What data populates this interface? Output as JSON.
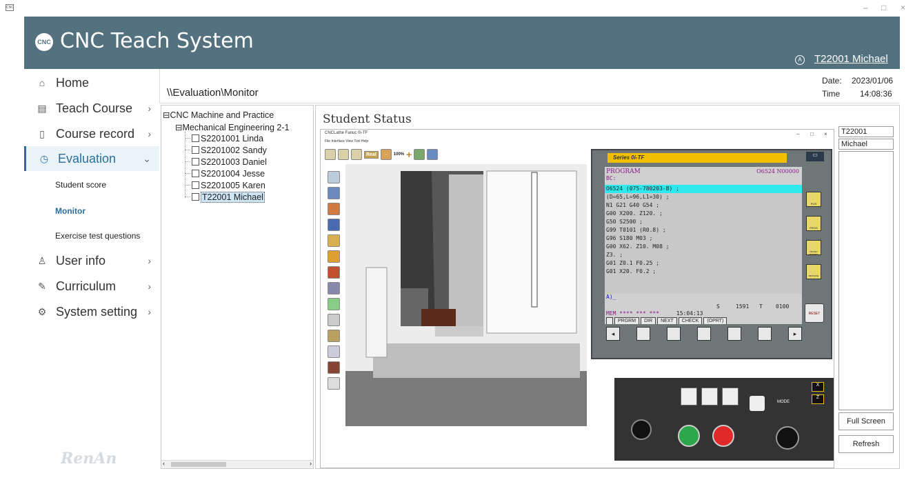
{
  "window": {
    "minimize": "–",
    "maximize": "□",
    "close": "×"
  },
  "header": {
    "title": "CNC Teach System",
    "user": "T22001 Michael"
  },
  "sidebar": {
    "items": [
      {
        "label": "Home",
        "icon": "home-icon"
      },
      {
        "label": "Teach Course",
        "icon": "book-icon"
      },
      {
        "label": "Course record",
        "icon": "document-icon"
      },
      {
        "label": "Evaluation",
        "icon": "clock-icon"
      },
      {
        "label": "User info",
        "icon": "user-icon"
      },
      {
        "label": "Curriculum",
        "icon": "pencil-icon"
      },
      {
        "label": "System setting",
        "icon": "gear-icon"
      }
    ],
    "sub_items": [
      "Student score",
      "Monitor",
      "Exercise test questions"
    ],
    "brand": "RenAn"
  },
  "breadcrumb": "\\\\Evaluation\\Monitor",
  "datetime": {
    "date_label": "Date:",
    "date": "2023/01/06",
    "time_label": "Time",
    "time": "14:08:36"
  },
  "tree": {
    "root": "CNC Machine and Practice",
    "group": "Mechanical Engineering 2-1",
    "students": [
      "S2201001 Linda",
      "S2201002 Sandy",
      "S2201003 Daniel",
      "S2201004 Jesse",
      "S2201005 Karen",
      "T22001 Michael"
    ]
  },
  "status": {
    "title": "Student Status"
  },
  "sim": {
    "title": "CNCLathe Fanuc 0i-TF",
    "menu": "File  Interface  View  Tool  Help",
    "zoom": "100%",
    "real": "Real",
    "series": "Series 0i-TF",
    "program_label": "PROGRAM",
    "program_no": "O6524  N00000",
    "bc": "BC:",
    "code": [
      "O6524 (075-780203-B) ;",
      "(D=65,L=96,L1=30) ;",
      "N1 G21 G40 G54 ;",
      "G00 X200. Z120. ;",
      "G50 S2500 ;",
      "G99 T0101 (R0.8) ;",
      "G96 S180 M03 ;",
      "G00 X62. Z10. M08 ;",
      "Z3. ;",
      "G01 Z0.1 F0.25 ;",
      "G01 X20. F0.2 ;"
    ],
    "input_line": "A)_",
    "s_label": "S",
    "s_value": "1591",
    "t_label": "T",
    "t_value": "0100",
    "mem": "MEM  ****  ***  ***",
    "clock": "15:04:13",
    "softkeys": [
      "PRGRM",
      "DIR",
      "NEXT",
      "CHECK",
      "(OPRT)"
    ],
    "side_keys": [
      "POS",
      "PROG",
      "OFFSET SETTING",
      "MESSAGE"
    ],
    "reset": "RESET",
    "mode": "MODE"
  },
  "right": {
    "id": "T22001",
    "name": "Michael",
    "full_screen": "Full Screen",
    "refresh": "Refresh"
  }
}
